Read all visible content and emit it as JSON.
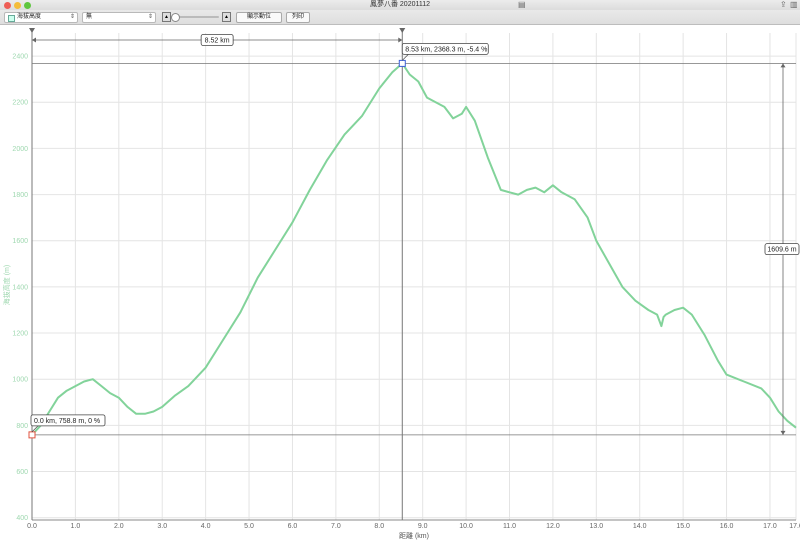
{
  "window": {
    "title": "鳳夢八番 20201112"
  },
  "toolbar": {
    "mode_select": "海拔高度",
    "secondary_select": "無",
    "show_units_button": "顯示動位",
    "print_button": "列印"
  },
  "chart_data": {
    "type": "line",
    "title": "",
    "xlabel": "距離 (km)",
    "ylabel": "海拔高度 (m)",
    "xlim": [
      0,
      17.6
    ],
    "ylim": [
      390,
      2500
    ],
    "x_ticks": [
      "0.0",
      "1.0",
      "2.0",
      "3.0",
      "4.0",
      "5.0",
      "6.0",
      "7.0",
      "8.0",
      "9.0",
      "10.0",
      "11.0",
      "12.0",
      "13.0",
      "14.0",
      "15.0",
      "16.0",
      "17.0",
      "17.6"
    ],
    "y_ticks": [
      "400",
      "600",
      "800",
      "1000",
      "1200",
      "1400",
      "1600",
      "1800",
      "2000",
      "2200",
      "2400"
    ],
    "series": [
      {
        "name": "",
        "color": "#82d39a",
        "x": [
          0.0,
          0.2,
          0.4,
          0.6,
          0.8,
          1.0,
          1.2,
          1.4,
          1.6,
          1.8,
          2.0,
          2.2,
          2.4,
          2.6,
          2.8,
          3.0,
          3.3,
          3.6,
          4.0,
          4.4,
          4.8,
          5.2,
          5.6,
          6.0,
          6.4,
          6.8,
          7.2,
          7.6,
          8.0,
          8.3,
          8.53,
          8.7,
          8.9,
          9.1,
          9.3,
          9.5,
          9.7,
          9.9,
          10.0,
          10.2,
          10.5,
          10.8,
          11.0,
          11.2,
          11.4,
          11.6,
          11.8,
          12.0,
          12.2,
          12.5,
          12.8,
          13.0,
          13.3,
          13.6,
          13.9,
          14.2,
          14.4,
          14.5,
          14.55,
          14.6,
          14.8,
          15.0,
          15.2,
          15.5,
          15.8,
          16.0,
          16.4,
          16.8,
          17.0,
          17.2,
          17.4,
          17.6
        ],
        "y": [
          758.8,
          800,
          860,
          920,
          950,
          970,
          990,
          1000,
          970,
          940,
          920,
          880,
          850,
          850,
          860,
          880,
          930,
          970,
          1050,
          1170,
          1290,
          1440,
          1560,
          1680,
          1820,
          1950,
          2060,
          2140,
          2260,
          2330,
          2368.3,
          2320,
          2290,
          2220,
          2200,
          2180,
          2130,
          2150,
          2180,
          2120,
          1960,
          1820,
          1810,
          1800,
          1820,
          1830,
          1810,
          1840,
          1810,
          1780,
          1700,
          1600,
          1500,
          1400,
          1340,
          1300,
          1280,
          1230,
          1270,
          1280,
          1300,
          1310,
          1280,
          1190,
          1080,
          1020,
          990,
          960,
          920,
          860,
          820,
          790
        ],
        "series_color": "#82d39a"
      }
    ],
    "annotations": {
      "start_point": "0.0 km, 758.8 m, 0 %",
      "cursor_point": "8.53 km, 2368.3 m, -5.4 %",
      "distance_span": "8.52 km",
      "elevation_span": "1609.6 m"
    },
    "grid": true,
    "legend": "none"
  }
}
